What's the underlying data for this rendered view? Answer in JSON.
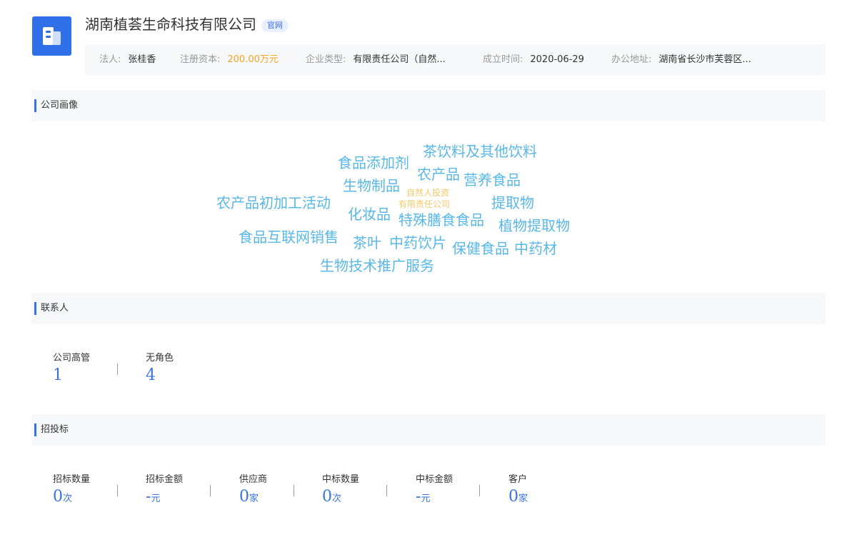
{
  "header": {
    "company_name": "湖南植荟生命科技有限公司",
    "official_tag": "官网",
    "logo_icon": "building-icon",
    "info": [
      {
        "label": "法人:",
        "value": "张桂香"
      },
      {
        "label": "注册资本:",
        "value": "200.00万元"
      },
      {
        "label": "企业类型:",
        "value": "有限责任公司（自然..."
      },
      {
        "label": "成立时间:",
        "value": "2020-06-29"
      },
      {
        "label": "办公地址:",
        "value": "湖南省长沙市芙蓉区..."
      }
    ]
  },
  "portrait": {
    "title": "公司画像",
    "words": [
      {
        "text": "茶饮料及其他饮料",
        "color": "#58b8e8"
      },
      {
        "text": "食品添加剂",
        "color": "#58b8e8"
      },
      {
        "text": "农产品",
        "color": "#58b8e8"
      },
      {
        "text": "营养食品",
        "color": "#58b8e8"
      },
      {
        "text": "生物制品",
        "color": "#58b8e8"
      },
      {
        "text": "自然人投资",
        "color": "#f5c96a"
      },
      {
        "text": "农产品初加工活动",
        "color": "#58b8e8"
      },
      {
        "text": "提取物",
        "color": "#58b8e8"
      },
      {
        "text": "有限责任公司",
        "color": "#f5c96a"
      },
      {
        "text": "化妆品",
        "color": "#58b8e8"
      },
      {
        "text": "特殊膳食食品",
        "color": "#58b8e8"
      },
      {
        "text": "植物提取物",
        "color": "#58b8e8"
      },
      {
        "text": "食品互联网销售",
        "color": "#58b8e8"
      },
      {
        "text": "茶叶",
        "color": "#58b8e8"
      },
      {
        "text": "中药饮片",
        "color": "#58b8e8"
      },
      {
        "text": "保健食品",
        "color": "#58b8e8"
      },
      {
        "text": "中药材",
        "color": "#58b8e8"
      },
      {
        "text": "生物技术推广服务",
        "color": "#58b8e8"
      }
    ]
  },
  "contacts": {
    "title": "联系人",
    "stats": [
      {
        "label": "公司高管",
        "value": "1",
        "unit": ""
      },
      {
        "label": "无角色",
        "value": "4",
        "unit": ""
      }
    ]
  },
  "bidding": {
    "title": "招投标",
    "stats": [
      {
        "label": "招标数量",
        "value": "0",
        "unit": "次"
      },
      {
        "label": "招标金额",
        "value": "-",
        "unit": "元"
      },
      {
        "label": "供应商",
        "value": "0",
        "unit": "家"
      },
      {
        "label": "中标数量",
        "value": "0",
        "unit": "次"
      },
      {
        "label": "中标金额",
        "value": "-",
        "unit": "元"
      },
      {
        "label": "客户",
        "value": "0",
        "unit": "家"
      }
    ]
  },
  "colors": {
    "accent": "#3873e0",
    "capital": "#f5a623",
    "tag_word": "#58b8e8",
    "tag_word_alt": "#f5c96a"
  }
}
